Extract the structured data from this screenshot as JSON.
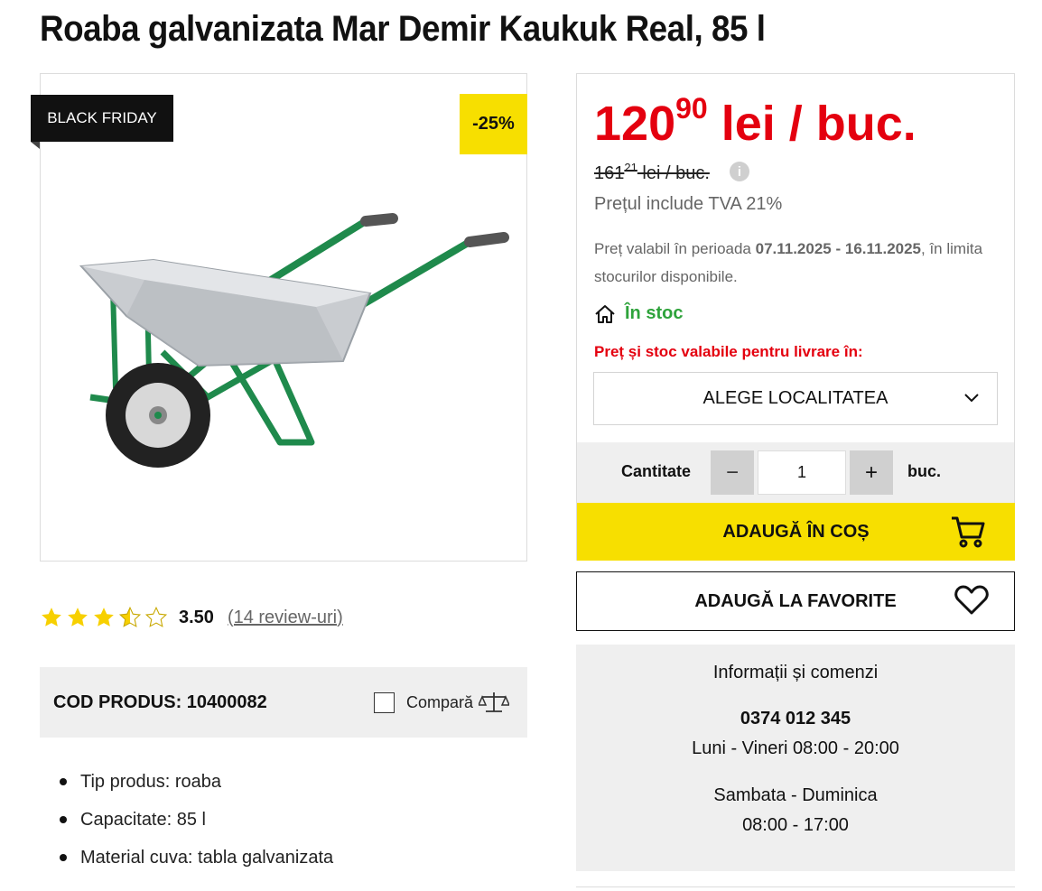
{
  "product": {
    "title": "Roaba galvanizata Mar Demir Kaukuk Real, 85 l",
    "badge_black_friday": "BLACK FRIDAY",
    "badge_discount": "-25%",
    "image_alt": "wheelbarrow",
    "rating": {
      "value": "3.50",
      "stars_filled": 3.5,
      "stars_total": 5,
      "reviews_link": "(14 review-uri)"
    },
    "code_label": "COD PRODUS: 10400082",
    "compare_label": "Compară",
    "specs": [
      "Tip produs: roaba",
      "Capacitate: 85 l",
      "Material cuva: tabla galvanizata"
    ]
  },
  "pricing": {
    "price_int": "120",
    "price_dec": "90",
    "price_suffix": " lei / buc.",
    "old_price_int": "161",
    "old_price_dec": "21",
    "old_price_suffix": " lei / buc.",
    "info_icon": "i",
    "vat_text": "Prețul include TVA 21%",
    "validity_prefix": "Preț valabil în perioada ",
    "validity_dates": "07.11.2025 - 16.11.2025",
    "validity_suffix": ", în limita stocurilor disponibile.",
    "stock_label": "În stoc",
    "delivery_note": "Preț și stoc valabile pentru livrare în:",
    "location_select": "ALEGE LOCALITATEA"
  },
  "cart": {
    "qty_label": "Cantitate",
    "qty_minus": "−",
    "qty_value": "1",
    "qty_plus": "+",
    "qty_unit": "buc.",
    "add_to_cart": "ADAUGĂ ÎN COȘ",
    "add_to_favorites": "ADAUGĂ LA FAVORITE"
  },
  "contact": {
    "title": "Informații și comenzi",
    "phone": "0374 012 345",
    "weekday_hours": "Luni - Vineri 08:00 - 20:00",
    "weekend_label": "Sambata - Duminica",
    "weekend_hours": "08:00 - 17:00"
  },
  "colors": {
    "accent_yellow": "#f7df00",
    "price_red": "#e4000f",
    "stock_green": "#2ea33b"
  },
  "icons": [
    "star-icon",
    "checkbox-icon",
    "scale-icon",
    "info-icon",
    "home-icon",
    "chevron-down-icon",
    "cart-icon",
    "heart-icon"
  ]
}
